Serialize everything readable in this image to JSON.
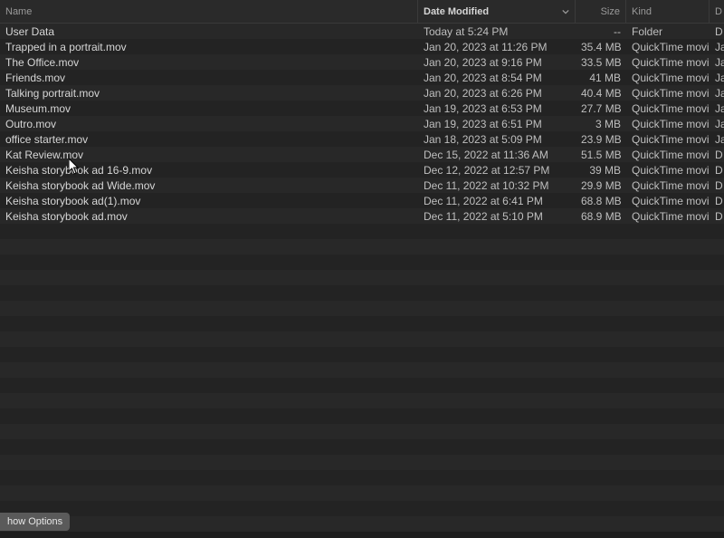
{
  "columns": {
    "name": "Name",
    "date": "Date Modified",
    "size": "Size",
    "kind": "Kind",
    "last": "D"
  },
  "files": [
    {
      "name": "User Data",
      "date": "Today at 5:24 PM",
      "size": "--",
      "kind": "Folder",
      "last": "D"
    },
    {
      "name": "Trapped in a portrait.mov",
      "date": "Jan 20, 2023 at 11:26 PM",
      "size": "35.4 MB",
      "kind": "QuickTime movie",
      "last": "Ja"
    },
    {
      "name": "The Office.mov",
      "date": "Jan 20, 2023 at 9:16 PM",
      "size": "33.5 MB",
      "kind": "QuickTime movie",
      "last": "Ja"
    },
    {
      "name": "Friends.mov",
      "date": "Jan 20, 2023 at 8:54 PM",
      "size": "41 MB",
      "kind": "QuickTime movie",
      "last": "Ja"
    },
    {
      "name": "Talking portrait.mov",
      "date": "Jan 20, 2023 at 6:26 PM",
      "size": "40.4 MB",
      "kind": "QuickTime movie",
      "last": "Ja"
    },
    {
      "name": "Museum.mov",
      "date": "Jan 19, 2023 at 6:53 PM",
      "size": "27.7 MB",
      "kind": "QuickTime movie",
      "last": "Ja"
    },
    {
      "name": "Outro.mov",
      "date": "Jan 19, 2023 at 6:51 PM",
      "size": "3 MB",
      "kind": "QuickTime movie",
      "last": "Ja"
    },
    {
      "name": "office starter.mov",
      "date": "Jan 18, 2023 at 5:09 PM",
      "size": "23.9 MB",
      "kind": "QuickTime movie",
      "last": "Ja"
    },
    {
      "name": "Kat Review.mov",
      "date": "Dec 15, 2022 at 11:36 AM",
      "size": "51.5 MB",
      "kind": "QuickTime movie",
      "last": "D"
    },
    {
      "name": "Keisha storybook ad 16-9.mov",
      "date": "Dec 12, 2022 at 12:57 PM",
      "size": "39 MB",
      "kind": "QuickTime movie",
      "last": "D"
    },
    {
      "name": "Keisha storybook ad Wide.mov",
      "date": "Dec 11, 2022 at 10:32 PM",
      "size": "29.9 MB",
      "kind": "QuickTime movie",
      "last": "D"
    },
    {
      "name": "Keisha storybook ad(1).mov",
      "date": "Dec 11, 2022 at 6:41 PM",
      "size": "68.8 MB",
      "kind": "QuickTime movie",
      "last": "D"
    },
    {
      "name": "Keisha storybook ad.mov",
      "date": "Dec 11, 2022 at 5:10 PM",
      "size": "68.9 MB",
      "kind": "QuickTime movie",
      "last": "D"
    }
  ],
  "footer": {
    "show_options": "how Options"
  }
}
